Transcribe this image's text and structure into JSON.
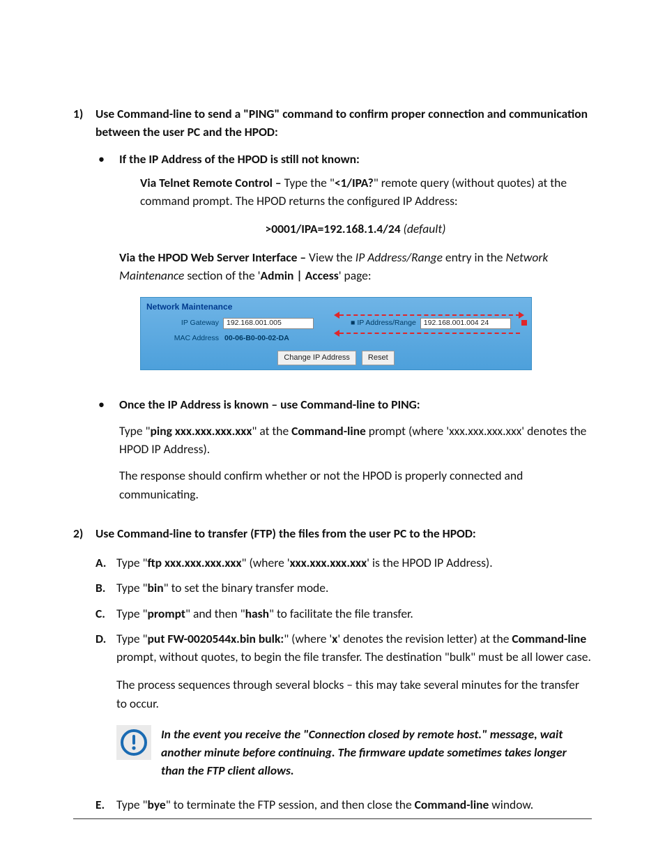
{
  "step1": {
    "marker": "1)",
    "heading_a": "Use Command-line to send a \"PING\" command to confirm proper connection and communication between the user PC and the HPOD:",
    "bullet1": {
      "title": "If the IP Address of the HPOD is still not known:",
      "telnet_lead": "Via Telnet Remote Control – ",
      "telnet_mid": "Type the \"",
      "telnet_cmd": "<1/IPA?",
      "telnet_after": "\" remote query (without quotes) at the command prompt. The HPOD returns the configured IP Address:",
      "response_bold": ">0001/IPA=192.168.1.4/24",
      "response_italic": " (default)",
      "web_lead": "Via the HPOD Web Server Interface – ",
      "web_mid1": "View the ",
      "web_em1": "IP Address/Range",
      "web_mid2": " entry in the ",
      "web_em2": "Network Maintenance",
      "web_mid3": " section of the '",
      "web_b1": "Admin | Access",
      "web_mid4": "' page:"
    },
    "bullet2": {
      "title": "Once the IP Address is known – use Command-line to PING:",
      "p1_a": "Type \"",
      "p1_cmd": "ping xxx.xxx.xxx.xxx",
      "p1_b": "\" at the ",
      "p1_bold": "Command-line",
      "p1_c": " prompt (where 'xxx.xxx.xxx.xxx' denotes the HPOD IP Address).",
      "p2": "The response should confirm whether or not the HPOD is properly connected and communicating."
    }
  },
  "nm": {
    "title": "Network Maintenance",
    "ip_gateway_label": "IP Gateway",
    "ip_gateway_value": "192.168.001.005",
    "mac_label": "MAC Address",
    "mac_value": "00-06-B0-00-02-DA",
    "ip_range_label": "IP Address/Range",
    "ip_range_value": "192.168.001.004 24",
    "btn_change": "Change IP Address",
    "btn_reset": "Reset"
  },
  "step2": {
    "marker": "2)",
    "heading": "Use Command-line to transfer (FTP) the files from the user PC to the HPOD:",
    "A": {
      "marker": "A.",
      "t1": "Type \"",
      "cmd": "ftp xxx.xxx.xxx.xxx",
      "t2": "\" (where '",
      "b2": "xxx.xxx.xxx.xxx",
      "t3": "' is the HPOD IP Address)."
    },
    "B": {
      "marker": "B.",
      "t1": "Type \"",
      "cmd": "bin",
      "t2": "\" to set the binary transfer mode."
    },
    "C": {
      "marker": "C.",
      "t1": "Type \"",
      "cmd1": "prompt",
      "t2": "\" and then \"",
      "cmd2": "hash",
      "t3": "\" to facilitate the file transfer."
    },
    "D": {
      "marker": "D.",
      "t1": "Type \"",
      "cmd": "put FW-0020544x.bin bulk:",
      "t2": "\" (where '",
      "b2": "x",
      "t3": "' denotes the revision letter) at the ",
      "b3": "Command-line",
      "t4": " prompt, without quotes, to begin the file transfer. The destination \"bulk\" must be all lower case.",
      "p2": "The process sequences through several blocks – this may take several minutes for the transfer to occur."
    },
    "alert": "In the event you receive the \"Connection closed by remote host.\" message, wait another minute before continuing. The firmware update sometimes takes longer than the FTP client allows.",
    "E": {
      "marker": "E.",
      "t1": "Type \"",
      "cmd": "bye",
      "t2": "\" to terminate the FTP session, and then close the ",
      "b2": "Command-line",
      "t3": " window."
    }
  }
}
